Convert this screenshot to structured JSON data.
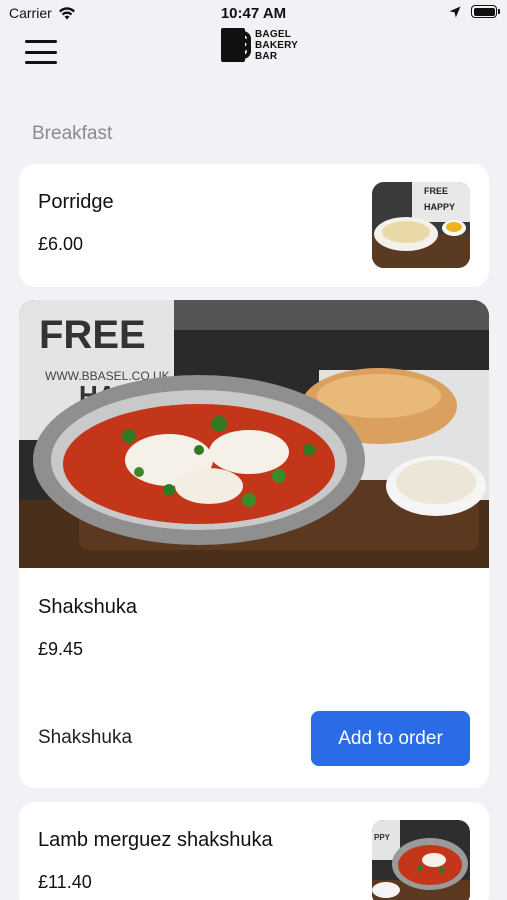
{
  "status_bar": {
    "carrier": "Carrier",
    "time": "10:47 AM"
  },
  "header": {
    "logo_lines": [
      "BAGEL",
      "BAKERY",
      "BAR"
    ]
  },
  "section": {
    "title": "Breakfast"
  },
  "items": [
    {
      "name": "Porridge",
      "price": "£6.00",
      "thumb": "porridge-photo"
    },
    {
      "name": "Shakshuka",
      "price": "£9.45",
      "variant": "Shakshuka",
      "add_label": "Add to order",
      "hero": "shakshuka-photo"
    },
    {
      "name": "Lamb merguez shakshuka",
      "price": "£11.40",
      "thumb": "merguez-shakshuka-photo"
    }
  ],
  "colors": {
    "accent": "#2a6be8",
    "background": "#f2f2f6",
    "card": "#ffffff",
    "section_title": "#8a8a8e"
  }
}
